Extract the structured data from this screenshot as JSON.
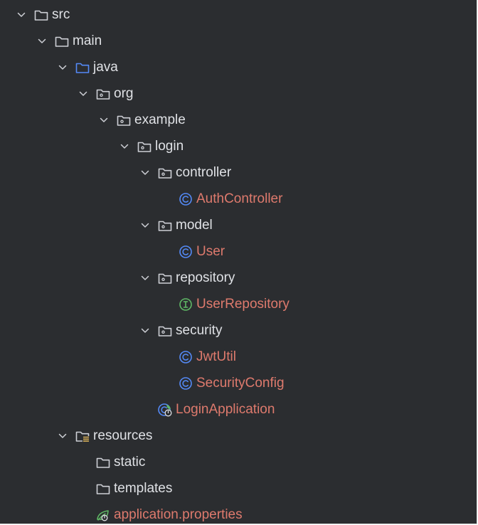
{
  "project_tree": {
    "nodes": [
      {
        "label": "src",
        "icon": "folder-icon",
        "depth": 0,
        "expanded": true,
        "kind": "folder"
      },
      {
        "label": "main",
        "icon": "folder-icon",
        "depth": 1,
        "expanded": true,
        "kind": "folder"
      },
      {
        "label": "java",
        "icon": "source-root-folder-icon",
        "depth": 2,
        "expanded": true,
        "kind": "folder"
      },
      {
        "label": "org",
        "icon": "package-icon",
        "depth": 3,
        "expanded": true,
        "kind": "folder"
      },
      {
        "label": "example",
        "icon": "package-icon",
        "depth": 4,
        "expanded": true,
        "kind": "folder"
      },
      {
        "label": "login",
        "icon": "package-icon",
        "depth": 5,
        "expanded": true,
        "kind": "folder"
      },
      {
        "label": "controller",
        "icon": "package-icon",
        "depth": 6,
        "expanded": true,
        "kind": "folder"
      },
      {
        "label": "AuthController",
        "icon": "class-icon",
        "depth": 7,
        "kind": "file"
      },
      {
        "label": "model",
        "icon": "package-icon",
        "depth": 6,
        "expanded": true,
        "kind": "folder"
      },
      {
        "label": "User",
        "icon": "class-icon",
        "depth": 7,
        "kind": "file"
      },
      {
        "label": "repository",
        "icon": "package-icon",
        "depth": 6,
        "expanded": true,
        "kind": "folder"
      },
      {
        "label": "UserRepository",
        "icon": "interface-icon",
        "depth": 7,
        "kind": "file"
      },
      {
        "label": "security",
        "icon": "package-icon",
        "depth": 6,
        "expanded": true,
        "kind": "folder"
      },
      {
        "label": "JwtUtil",
        "icon": "class-icon",
        "depth": 7,
        "kind": "file"
      },
      {
        "label": "SecurityConfig",
        "icon": "class-icon",
        "depth": 7,
        "kind": "file"
      },
      {
        "label": "LoginApplication",
        "icon": "spring-boot-class-icon",
        "depth": 6,
        "kind": "file"
      },
      {
        "label": "resources",
        "icon": "resources-root-folder-icon",
        "depth": 2,
        "expanded": true,
        "kind": "folder"
      },
      {
        "label": "static",
        "icon": "folder-icon",
        "depth": 3,
        "kind": "folder-collapsed"
      },
      {
        "label": "templates",
        "icon": "folder-icon",
        "depth": 3,
        "kind": "folder-collapsed"
      },
      {
        "label": "application.properties",
        "icon": "spring-properties-icon",
        "depth": 3,
        "kind": "file"
      }
    ]
  },
  "colors": {
    "background": "#2b2d30",
    "text": "#dfe1e5",
    "class_text": "#de7a6d",
    "class_icon": "#548af7",
    "interface_icon": "#5fb865",
    "spring_icon": "#5fb865",
    "folder_icon": "#ced0d6",
    "source_root_icon": "#548af7",
    "resources_badge": "#d6ae58"
  }
}
